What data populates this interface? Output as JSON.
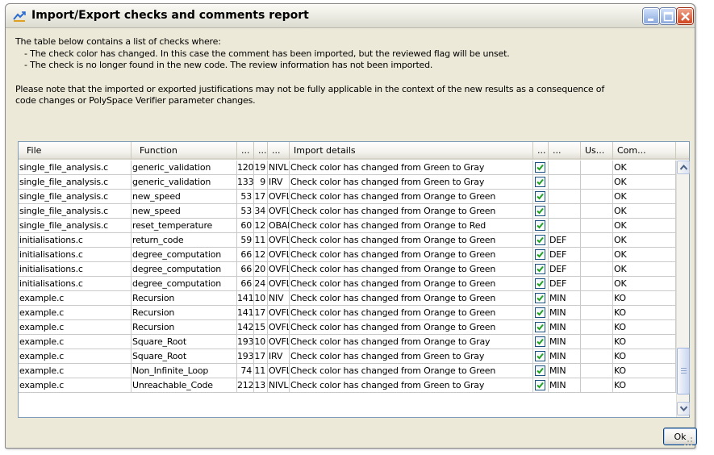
{
  "window": {
    "title": "Import/Export checks and comments report",
    "accent": "#0a246a"
  },
  "description": {
    "intro": "The table below contains a list of checks where:",
    "bullet_1": "- The check color has changed. In this case the comment has been imported, but the reviewed flag will be unset.",
    "bullet_2": "- The check is no longer found in the new code. The review information has not been imported.",
    "note_line_1": "Please note that the imported or exported justifications may not be fully applicable in the context of the new results as a consequence of",
    "note_line_2": "code changes or PolySpace Verifier parameter changes."
  },
  "table": {
    "columns": [
      "File",
      "Function",
      "...",
      "...",
      "...",
      "Import details",
      "...",
      "...",
      "Us...",
      "Com..."
    ],
    "rows": [
      {
        "file": "single_file_analysis.c",
        "function": "generic_validation",
        "line": "120",
        "col": "19",
        "check": "NIVL",
        "details": "Check color has changed from Green to Gray",
        "checked": true,
        "classification": "",
        "user": "",
        "comment": "OK"
      },
      {
        "file": "single_file_analysis.c",
        "function": "generic_validation",
        "line": "133",
        "col": "9",
        "check": "IRV",
        "details": "Check color has changed from Green to Gray",
        "checked": true,
        "classification": "",
        "user": "",
        "comment": "OK"
      },
      {
        "file": "single_file_analysis.c",
        "function": "new_speed",
        "line": "53",
        "col": "17",
        "check": "OVFL",
        "details": "Check color has changed from Orange to Green",
        "checked": true,
        "classification": "",
        "user": "",
        "comment": "OK"
      },
      {
        "file": "single_file_analysis.c",
        "function": "new_speed",
        "line": "53",
        "col": "34",
        "check": "OVFL",
        "details": "Check color has changed from Orange to Green",
        "checked": true,
        "classification": "",
        "user": "",
        "comment": "OK"
      },
      {
        "file": "single_file_analysis.c",
        "function": "reset_temperature",
        "line": "60",
        "col": "12",
        "check": "OBAI",
        "details": "Check color has changed from Orange to Red",
        "checked": true,
        "classification": "",
        "user": "",
        "comment": "OK"
      },
      {
        "file": "initialisations.c",
        "function": "return_code",
        "line": "59",
        "col": "11",
        "check": "OVFL",
        "details": "Check color has changed from Orange to Green",
        "checked": true,
        "classification": "DEF",
        "user": "",
        "comment": "OK"
      },
      {
        "file": "initialisations.c",
        "function": "degree_computation",
        "line": "66",
        "col": "12",
        "check": "OVFL",
        "details": "Check color has changed from Orange to Green",
        "checked": true,
        "classification": "DEF",
        "user": "",
        "comment": "OK"
      },
      {
        "file": "initialisations.c",
        "function": "degree_computation",
        "line": "66",
        "col": "20",
        "check": "OVFL",
        "details": "Check color has changed from Orange to Green",
        "checked": true,
        "classification": "DEF",
        "user": "",
        "comment": "OK"
      },
      {
        "file": "initialisations.c",
        "function": "degree_computation",
        "line": "66",
        "col": "24",
        "check": "OVFL",
        "details": "Check color has changed from Orange to Green",
        "checked": true,
        "classification": "DEF",
        "user": "",
        "comment": "OK"
      },
      {
        "file": "example.c",
        "function": "Recursion",
        "line": "141",
        "col": "10",
        "check": "NIV",
        "details": "Check color has changed from Orange to Green",
        "checked": true,
        "classification": "MIN",
        "user": "",
        "comment": "KO"
      },
      {
        "file": "example.c",
        "function": "Recursion",
        "line": "141",
        "col": "17",
        "check": "OVFL",
        "details": "Check color has changed from Orange to Green",
        "checked": true,
        "classification": "MIN",
        "user": "",
        "comment": "KO"
      },
      {
        "file": "example.c",
        "function": "Recursion",
        "line": "142",
        "col": "15",
        "check": "OVFL",
        "details": "Check color has changed from Orange to Green",
        "checked": true,
        "classification": "MIN",
        "user": "",
        "comment": "KO"
      },
      {
        "file": "example.c",
        "function": "Square_Root",
        "line": "193",
        "col": "10",
        "check": "OVFL",
        "details": "Check color has changed from Orange to Gray",
        "checked": true,
        "classification": "MIN",
        "user": "",
        "comment": "KO"
      },
      {
        "file": "example.c",
        "function": "Square_Root",
        "line": "193",
        "col": "17",
        "check": "IRV",
        "details": "Check color has changed from Green to Gray",
        "checked": true,
        "classification": "MIN",
        "user": "",
        "comment": "KO"
      },
      {
        "file": "example.c",
        "function": "Non_Infinite_Loop",
        "line": "74",
        "col": "11",
        "check": "OVFL",
        "details": "Check color has changed from Orange to Green",
        "checked": true,
        "classification": "MIN",
        "user": "",
        "comment": "KO"
      },
      {
        "file": "example.c",
        "function": "Unreachable_Code",
        "line": "212",
        "col": "13",
        "check": "NIVL",
        "details": "Check color has changed from Green to Gray",
        "checked": true,
        "classification": "MIN",
        "user": "",
        "comment": "KO"
      }
    ]
  },
  "ok_button": {
    "label": "Ok"
  },
  "icons": [
    "app-icon",
    "minimize-icon",
    "maximize-icon",
    "close-icon",
    "checkbox-checked-icon",
    "scroll-up-icon",
    "scroll-down-icon",
    "resize-grip-icon"
  ]
}
